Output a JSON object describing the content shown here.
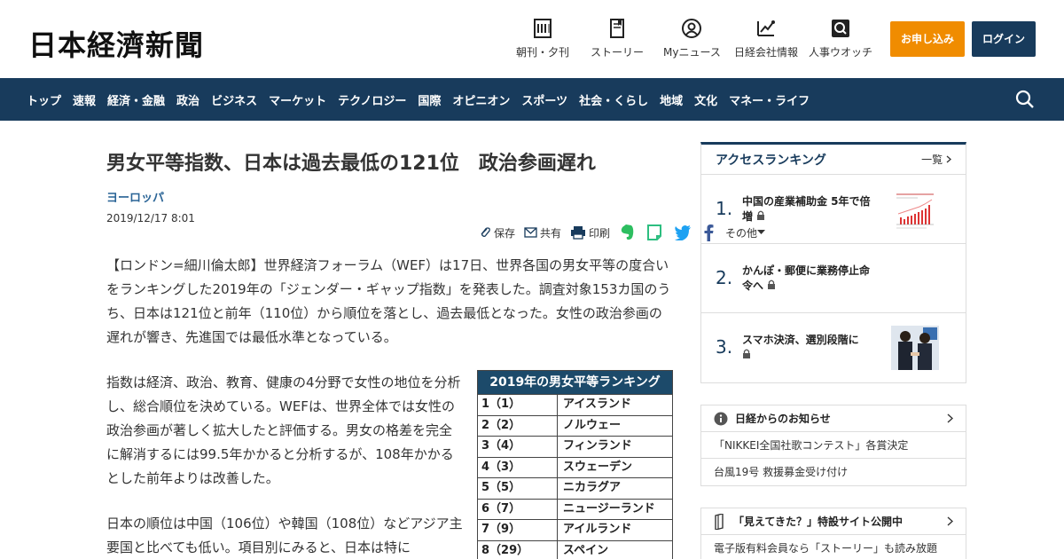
{
  "header": {
    "logo": "日本経濟新聞",
    "tools": [
      {
        "icon": "newspaper-icon",
        "label": "朝刊・夕刊"
      },
      {
        "icon": "story-book-icon",
        "label": "ストーリー"
      },
      {
        "icon": "user-icon",
        "label": "Myニュース"
      },
      {
        "icon": "company-chart-icon",
        "label": "日経会社情報"
      },
      {
        "icon": "people-search-icon",
        "label": "人事ウオッチ"
      }
    ],
    "subscribe_label": "お申し込み",
    "login_label": "ログイン"
  },
  "nav": {
    "items": [
      "トップ",
      "速報",
      "経済・金融",
      "政治",
      "ビジネス",
      "マーケット",
      "テクノロジー",
      "国際",
      "オピニオン",
      "スポーツ",
      "社会・くらし",
      "地域",
      "文化",
      "マネー・ライフ"
    ]
  },
  "article": {
    "title": "男女平等指数、日本は過去最低の121位　政治参画遅れ",
    "region": "ヨーロッパ",
    "date": "2019/12/17 8:01",
    "share": {
      "save": "保存",
      "share": "共有",
      "print": "印刷",
      "more": "その他"
    },
    "p1": "【ロンドン=細川倫太郎】世界経済フォーラム（WEF）は17日、世界各国の男女平等の度合いをランキングした2019年の「ジェンダー・ギャップ指数」を発表した。調査対象153カ国のうち、日本は121位と前年（110位）から順位を落とし、過去最低となった。女性の政治参画の遅れが響き、先進国では最低水準となっている。",
    "p2": "指数は経済、政治、教育、健康の4分野で女性の地位を分析し、総合順位を決めている。WEFは、世界全体では女性の政治参画が著しく拡大したと評価する。男女の格差を完全に解消するには99.5年かかると分析するが、108年かかるとした前年よりは改善した。",
    "p3": "日本の順位は中国（106位）や韓国（108位）などアジア主要国と比べても低い。項目別にみると、日本は特に",
    "ranking": {
      "title": "2019年の男女平等ランキング",
      "rows": [
        {
          "rank": "1（1）",
          "country": "アイスランド"
        },
        {
          "rank": "2（2）",
          "country": "ノルウェー"
        },
        {
          "rank": "3（4）",
          "country": "フィンランド"
        },
        {
          "rank": "4（3）",
          "country": "スウェーデン"
        },
        {
          "rank": "5（5）",
          "country": "ニカラグア"
        },
        {
          "rank": "6（7）",
          "country": "ニュージーランド"
        },
        {
          "rank": "7（9）",
          "country": "アイルランド"
        },
        {
          "rank": "8（29）",
          "country": "スペイン"
        }
      ]
    }
  },
  "sidebar": {
    "access": {
      "title": "アクセスランキング",
      "more": "一覧",
      "items": [
        {
          "num": "1.",
          "text": "中国の産業補助金 5年で倍増"
        },
        {
          "num": "2.",
          "text": "かんぽ・郵便に業務停止命令へ"
        },
        {
          "num": "3.",
          "text": "スマホ決済、選別段階に"
        }
      ]
    },
    "notice": {
      "title": "日経からのお知らせ",
      "rows": [
        "「NIKKEI全国社歌コンテスト」各賞決定",
        "台風19号 救援募金受け付け"
      ]
    },
    "story": {
      "title": "「見えてきた？」特設サイト公開中",
      "row": "電子版有料会員なら「ストーリー」も読み放題"
    }
  },
  "colors": {
    "navy": "#183b5c",
    "orange": "#f08c00",
    "link": "#2a6496"
  }
}
